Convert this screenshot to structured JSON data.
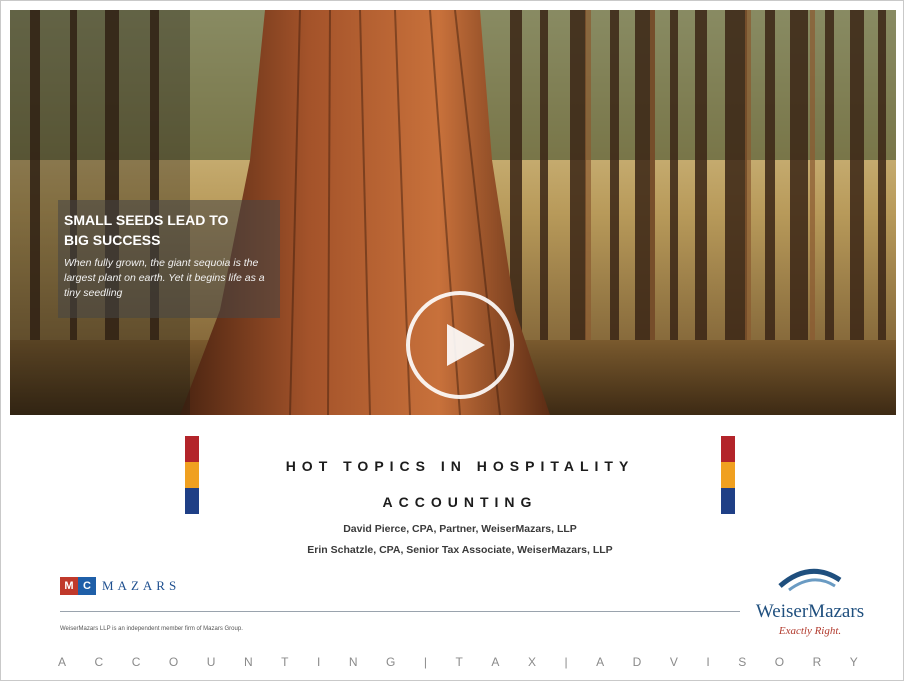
{
  "hero": {
    "callout_title_line1": "SMALL SEEDS LEAD TO",
    "callout_title_line2": "BIG SUCCESS",
    "callout_body": "When fully grown, the giant sequoia is the largest plant on earth. Yet it begins life as a tiny seedling",
    "play_icon": "play-icon"
  },
  "slide": {
    "title_line1": "HOT TOPICS IN HOSPITALITY",
    "title_line2": "ACCOUNTING",
    "presenter1": "David Pierce, CPA, Partner, WeiserMazars, LLP",
    "presenter2": "Erin Schatzle, CPA, Senior Tax Associate, WeiserMazars, LLP",
    "bar_colors": [
      "#b3242a",
      "#f0a020",
      "#1f3f86"
    ]
  },
  "branding": {
    "mazars_box_left": "M",
    "mazars_box_right": "C",
    "mazars_word": "MAZARS",
    "disclaimer": "WeiserMazars LLP is an independent member firm of Mazars Group.",
    "weisermazars_name": "WeiserMazars",
    "weisermazars_tagline": "Exactly Right."
  },
  "footer": {
    "items": [
      "A",
      "C",
      "C",
      "O",
      "U",
      "N",
      "T",
      "I",
      "N",
      "G",
      "|",
      "T",
      "A",
      "X",
      "|",
      "A",
      "D",
      "V",
      "I",
      "S",
      "O",
      "R",
      "Y"
    ]
  }
}
